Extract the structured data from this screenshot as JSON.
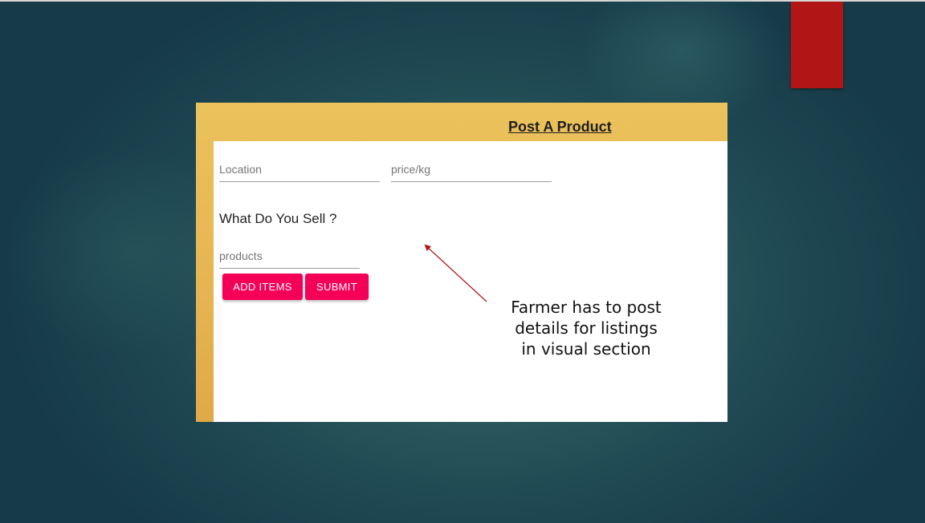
{
  "form": {
    "title": "Post A Product",
    "location_placeholder": "Location",
    "price_placeholder": "price/kg",
    "question": "What Do You Sell ?",
    "products_placeholder": "products",
    "add_items_label": "ADD ITEMS",
    "submit_label": "SUBMIT"
  },
  "annotation": {
    "lines": [
      "Farmer has to post",
      "details for listings",
      "in visual section"
    ]
  },
  "colors": {
    "card_header": "#ebc25c",
    "button": "#f50057",
    "tab": "#b11515",
    "arrow": "#b11515"
  }
}
